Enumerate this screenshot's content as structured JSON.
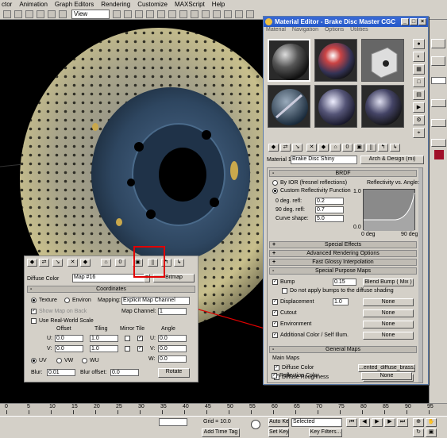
{
  "menubar": [
    "ctor",
    "Animation",
    "Graph Editors",
    "Rendering",
    "Customize",
    "MAXScript",
    "Help"
  ],
  "toolbar": {
    "view_select": "View"
  },
  "material_editor": {
    "title": "Material Editor - Brake Disc Master CGC",
    "menu": [
      "Material",
      "Navigation",
      "Options",
      "Utilities"
    ],
    "material_label": "Material 1:",
    "material_name": "Brake Disc Shiny",
    "material_type": "Arch & Design (mi)",
    "brdf": {
      "header": "BRDF",
      "by_ior": "By IOR (fresnel reflections)",
      "custom": "Custom Reflectivity Function",
      "refl_vs_angle": "Reflectivity vs. Angle:",
      "deg0_label": "0 deg. refl:",
      "deg0_value": "0.2",
      "deg90_label": "90 deg. refl:",
      "deg90_value": "0.7",
      "curve_label": "Curve shape:",
      "curve_value": "5.0",
      "graph_top": "1.0",
      "graph_bottom": "0.0",
      "graph_x0": "0 deg",
      "graph_x1": "90 deg"
    },
    "rollouts": [
      "Special Effects",
      "Advanced Rendering Options",
      "Fast Glossy Interpolation",
      "Special Purpose Maps"
    ],
    "spm": {
      "bump_label": "Bump",
      "bump_value": "0.15",
      "bump_map": "Blend Bump ( Mix )",
      "no_bump_diffuse": "Do not apply bumps to the diffuse shading",
      "disp_label": "Displacement",
      "disp_value": "1.0",
      "disp_map": "None",
      "cutout_label": "Cutout",
      "cutout_map": "None",
      "env_label": "Environment",
      "env_map": "None",
      "addcolor_label": "Additional Color / Self Illum.",
      "addcolor_map": "None"
    },
    "general_maps": {
      "header": "General Maps",
      "group": "Main Maps",
      "diffuse_color": "Diffuse Color",
      "diffuse_map": "...ented_diffuse_brass.tif)",
      "diffuse_rough": "Diffuse Roughness",
      "diffuse_rough_map": "None",
      "refl_color": "Reflection Color",
      "refl_color_map": "None"
    }
  },
  "coord_panel": {
    "diffuse_label": "Diffuse Color",
    "map_name": "Map #16",
    "bitmap_label": "Bitmap",
    "header": "Coordinates",
    "texture": "Texture",
    "environ": "Environ",
    "mapping_label": "Mapping:",
    "mapping_value": "Explicit Map Channel",
    "show_map_back": "Show Map on Back",
    "map_channel_label": "Map Channel:",
    "map_channel_value": "1",
    "real_world": "Use Real-World Scale",
    "offset": "Offset",
    "tiling": "Tiling",
    "mirror_tile": "Mirror Tile",
    "angle": "Angle",
    "u": "U:",
    "v": "V:",
    "w": "W:",
    "u_offset": "0.0",
    "v_offset": "0.0",
    "u_tiling": "1.0",
    "v_tiling": "1.0",
    "u_angle": "0.0",
    "v_angle": "0.0",
    "w_angle": "0.0",
    "uv": "UV",
    "vw": "VW",
    "wu": "WU",
    "blur_label": "Blur:",
    "blur_value": "0.01",
    "blur_offset_label": "Blur offset:",
    "blur_offset_value": "0.0",
    "rotate": "Rotate"
  },
  "timeline": {
    "labels": [
      "0",
      "5",
      "10",
      "15",
      "20",
      "25",
      "30",
      "35",
      "40",
      "45",
      "50",
      "55",
      "60",
      "65",
      "70",
      "75",
      "80",
      "85",
      "90",
      "95"
    ]
  },
  "status": {
    "grid": "Grid = 10.0",
    "add_time_tag": "Add Time Tag",
    "auto_key": "Auto Key",
    "selected": "Selected",
    "set_key": "Set Key",
    "key_filters": "Key Filters..."
  },
  "colors": {
    "title_bar": "#2458c8",
    "highlight": "#e00000",
    "panel": "#d4d0c8"
  }
}
